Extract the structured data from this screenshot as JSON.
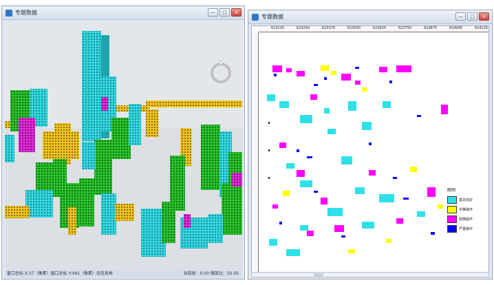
{
  "left_window": {
    "title": "专题数据",
    "controls": [
      "—",
      "□",
      "×"
    ],
    "status_left": "窗口坐标 X:37（像素）窗口坐标 Y:495（像素）无信息框",
    "status_right": "当前级：0.00  缩放比：50.00"
  },
  "right_window": {
    "title": "专题数据",
    "controls": [
      "—",
      "□",
      "×"
    ],
    "ruler_labels": [
      "623125",
      "623250",
      "623375",
      "623500",
      "623625",
      "623750",
      "623875",
      "624000",
      "624125"
    ]
  },
  "legend": {
    "title": "图例",
    "items": [
      {
        "label": "基本完好",
        "color": "#2fe0e8"
      },
      {
        "label": "中等破坏",
        "color": "#ffff00"
      },
      {
        "label": "轻微破坏",
        "color": "#ff00ff"
      },
      {
        "label": "严重破坏",
        "color": "#0000ff"
      }
    ]
  }
}
